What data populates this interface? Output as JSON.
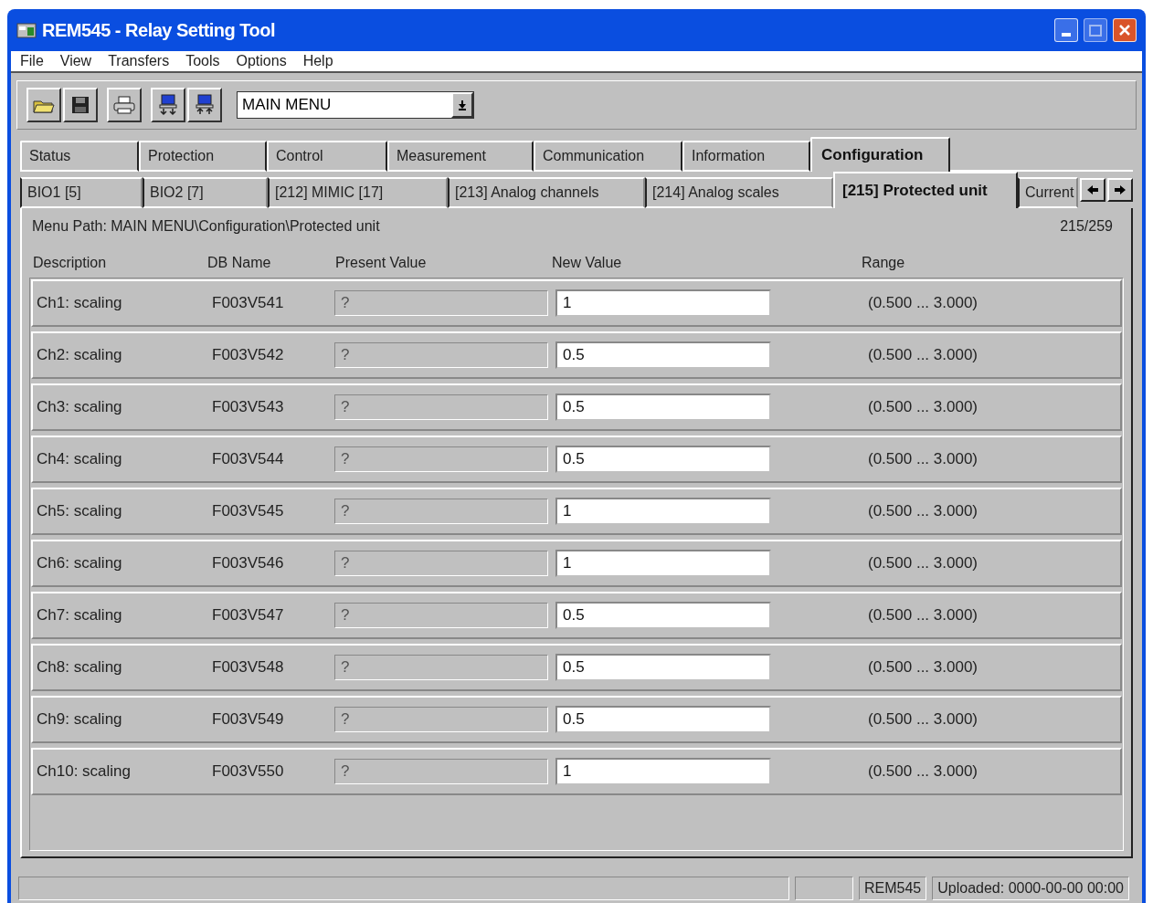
{
  "window": {
    "title": "REM545 - Relay Setting Tool"
  },
  "menu": [
    "File",
    "View",
    "Transfers",
    "Tools",
    "Options",
    "Help"
  ],
  "toolbar": {
    "combo_value": "MAIN MENU"
  },
  "main_tabs": [
    {
      "label": "Status",
      "selected": false
    },
    {
      "label": "Protection",
      "selected": false
    },
    {
      "label": "Control",
      "selected": false
    },
    {
      "label": "Measurement",
      "selected": false
    },
    {
      "label": "Communication",
      "selected": false
    },
    {
      "label": "Information",
      "selected": false
    },
    {
      "label": "Configuration",
      "selected": true
    }
  ],
  "sub_tabs": [
    {
      "label": "BIO1 [5]",
      "selected": false
    },
    {
      "label": "BIO2 [7]",
      "selected": false
    },
    {
      "label": "[212] MIMIC [17]",
      "selected": false
    },
    {
      "label": "[213] Analog channels",
      "selected": false
    },
    {
      "label": "[214] Analog scales",
      "selected": false
    },
    {
      "label": "[215] Protected unit",
      "selected": true
    },
    {
      "label": "Current",
      "selected": false
    }
  ],
  "menu_path": "Menu Path:  MAIN MENU\\Configuration\\Protected unit",
  "page_counter": "215/259",
  "table": {
    "columns": [
      "Description",
      "DB Name",
      "Present Value",
      "New Value",
      "Range"
    ],
    "rows": [
      {
        "description": "Ch1: scaling",
        "db_name": "F003V541",
        "present_value": "?",
        "new_value": "1",
        "range": "(0.500 ... 3.000)"
      },
      {
        "description": "Ch2: scaling",
        "db_name": "F003V542",
        "present_value": "?",
        "new_value": "0.5",
        "range": "(0.500 ... 3.000)"
      },
      {
        "description": "Ch3: scaling",
        "db_name": "F003V543",
        "present_value": "?",
        "new_value": "0.5",
        "range": "(0.500 ... 3.000)"
      },
      {
        "description": "Ch4: scaling",
        "db_name": "F003V544",
        "present_value": "?",
        "new_value": "0.5",
        "range": "(0.500 ... 3.000)"
      },
      {
        "description": "Ch5: scaling",
        "db_name": "F003V545",
        "present_value": "?",
        "new_value": "1",
        "range": "(0.500 ... 3.000)"
      },
      {
        "description": "Ch6: scaling",
        "db_name": "F003V546",
        "present_value": "?",
        "new_value": "1",
        "range": "(0.500 ... 3.000)"
      },
      {
        "description": "Ch7: scaling",
        "db_name": "F003V547",
        "present_value": "?",
        "new_value": "0.5",
        "range": "(0.500 ... 3.000)"
      },
      {
        "description": "Ch8: scaling",
        "db_name": "F003V548",
        "present_value": "?",
        "new_value": "0.5",
        "range": "(0.500 ... 3.000)"
      },
      {
        "description": "Ch9: scaling",
        "db_name": "F003V549",
        "present_value": "?",
        "new_value": "0.5",
        "range": "(0.500 ... 3.000)"
      },
      {
        "description": "Ch10: scaling",
        "db_name": "F003V550",
        "present_value": "?",
        "new_value": "1",
        "range": "(0.500 ... 3.000)"
      }
    ]
  },
  "status_bar": {
    "device": "REM545",
    "uploaded": "Uploaded: 0000-00-00 00:00"
  }
}
